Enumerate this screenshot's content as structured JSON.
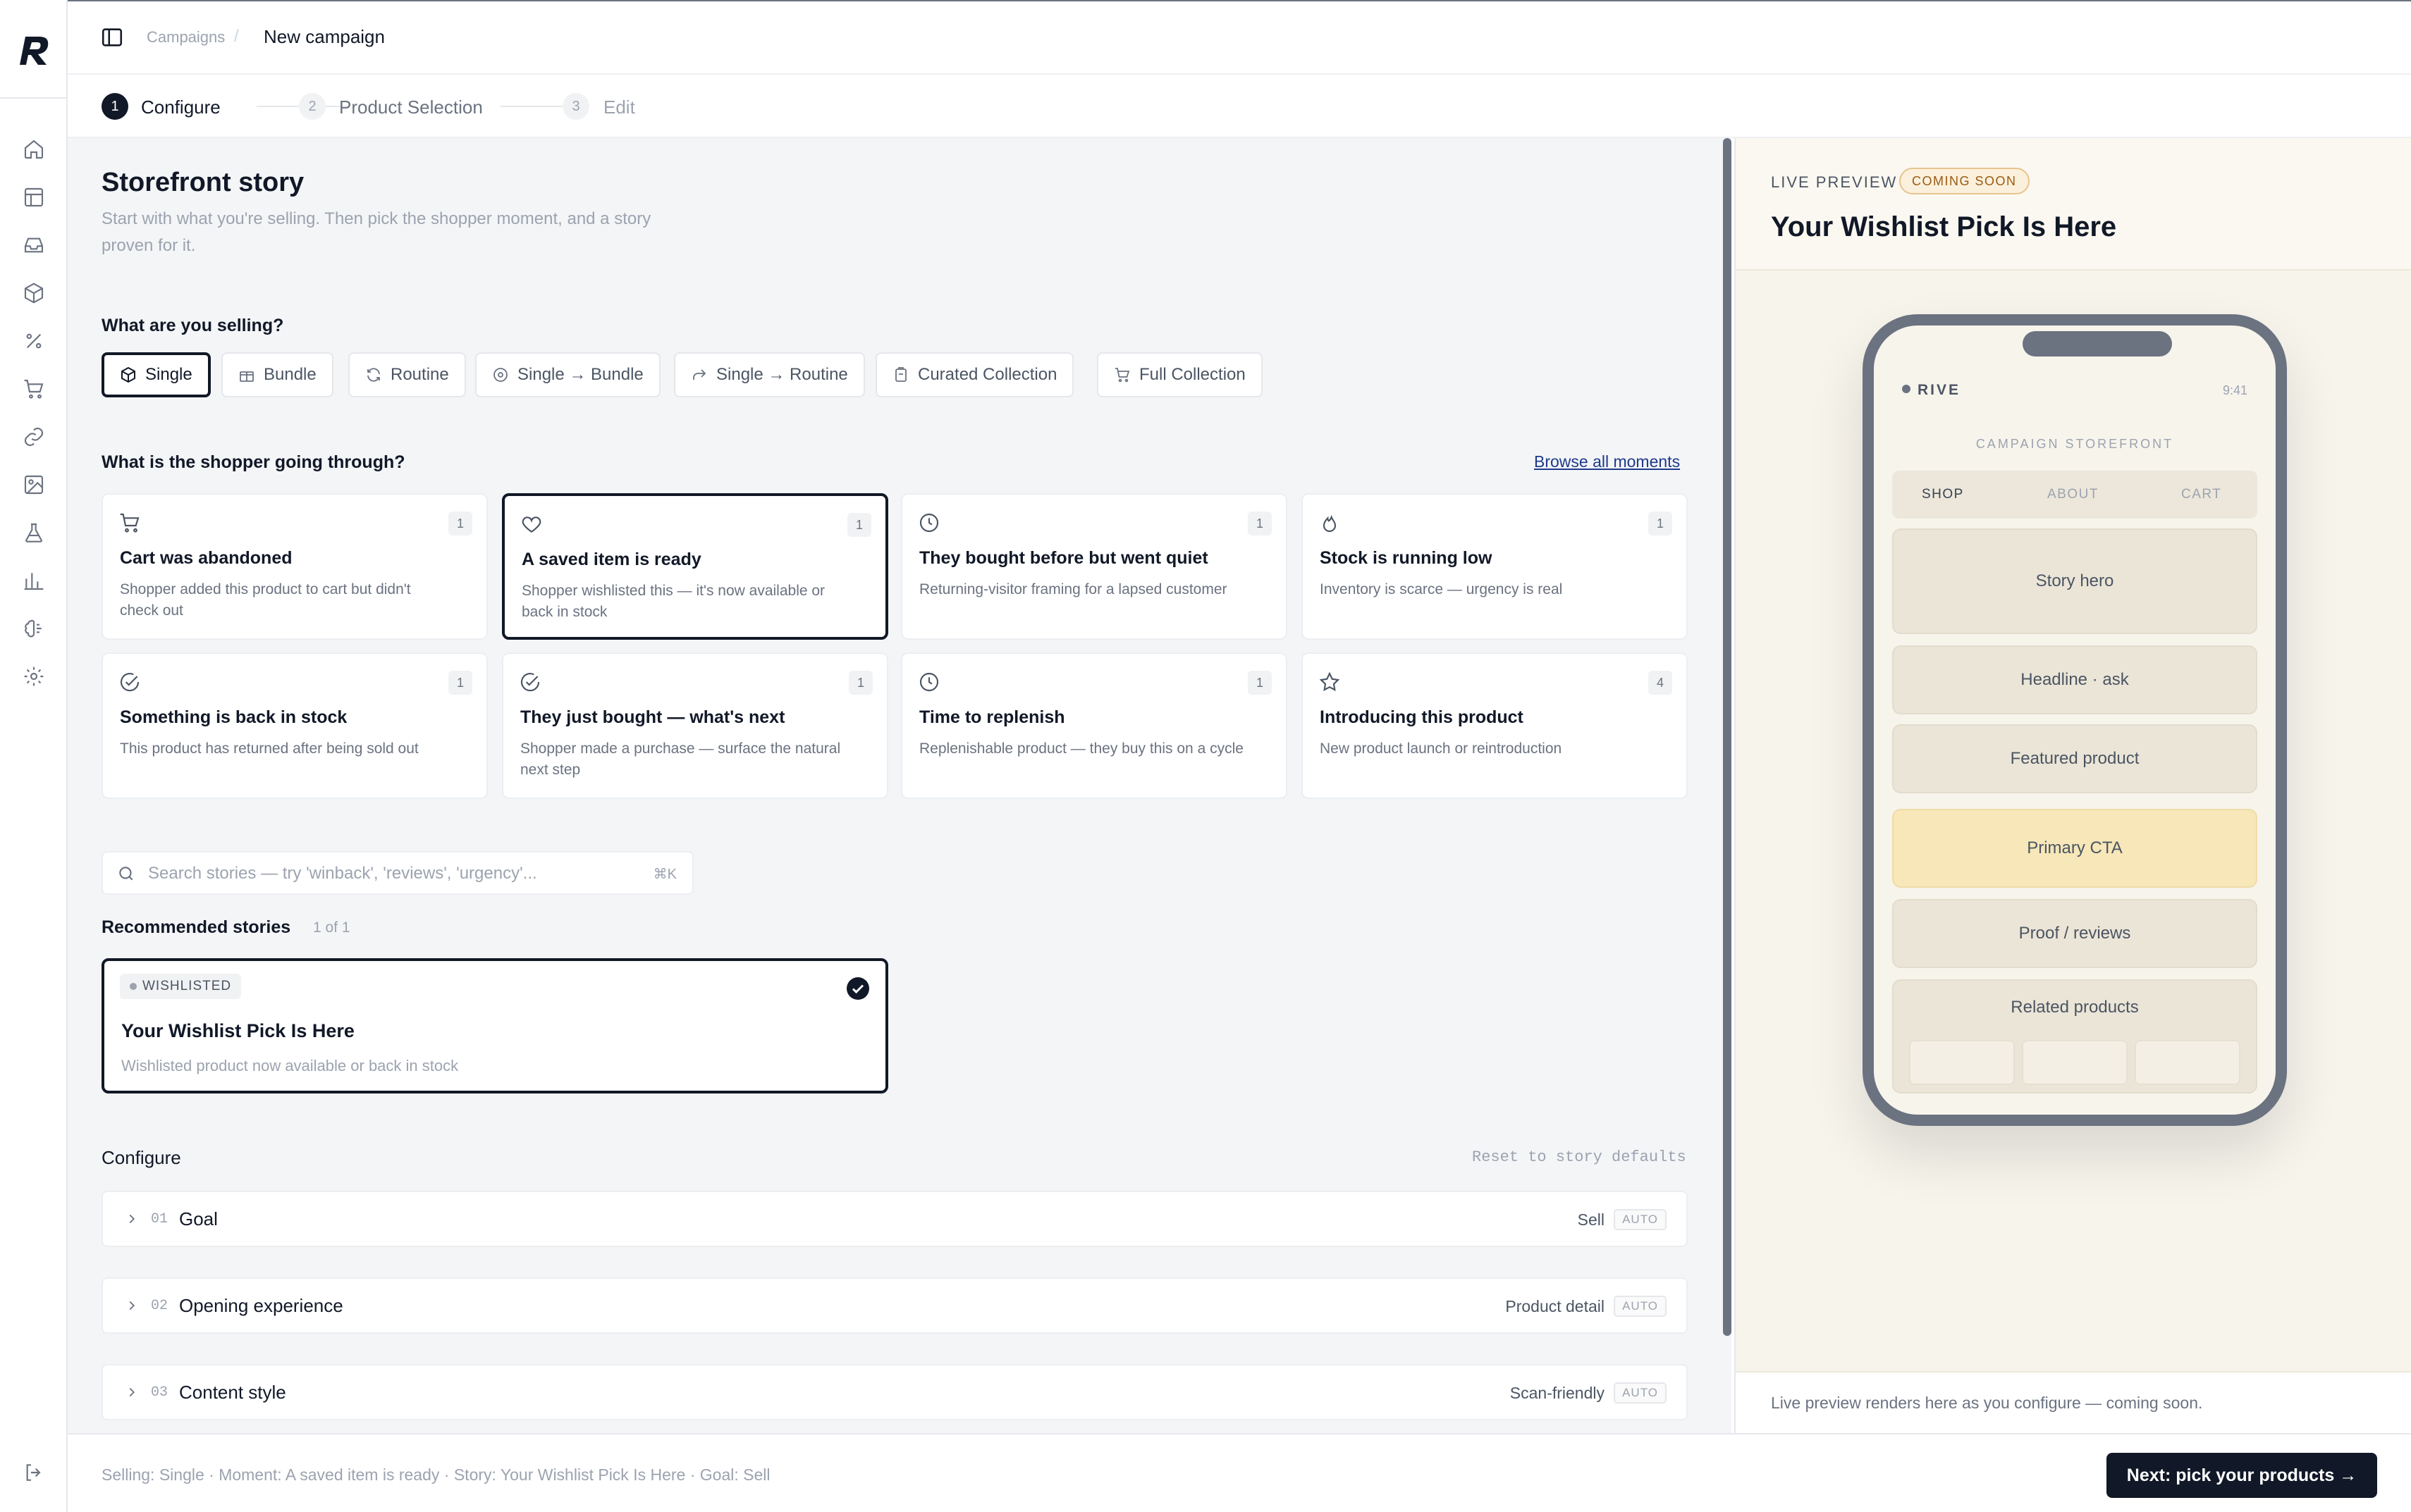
{
  "breadcrumb": {
    "parent": "Campaigns",
    "separator": "/",
    "current": "New campaign"
  },
  "stepper": [
    {
      "num": "1",
      "label": "Configure",
      "state": "active"
    },
    {
      "num": "2",
      "label": "Product Selection",
      "state": "todo"
    },
    {
      "num": "3",
      "label": "Edit",
      "state": "todo"
    }
  ],
  "main": {
    "title": "Storefront story",
    "subtitle_line1": "Start with what you're selling. Then pick the shopper moment, and a story",
    "subtitle_line2": "proven for it.",
    "selling_label": "What are you selling?",
    "selling_options": [
      {
        "label": "Single",
        "icon": "box-icon",
        "selected": true
      },
      {
        "label": "Bundle",
        "icon": "gift-icon",
        "selected": false
      },
      {
        "label": "Routine",
        "icon": "refresh-icon",
        "selected": false
      },
      {
        "label": "Single → Bundle",
        "icon": "circle-plus-icon",
        "selected": false
      },
      {
        "label": "Single → Routine",
        "icon": "share-arrow-icon",
        "selected": false
      },
      {
        "label": "Curated Collection",
        "icon": "clipboard-icon",
        "selected": false
      },
      {
        "label": "Full Collection",
        "icon": "cart-icon",
        "selected": false
      }
    ],
    "shopper_label": "What is the shopper going through?",
    "browse_link": "Browse all moments",
    "moments": [
      {
        "title": "Cart was abandoned",
        "desc": "Shopper added this product to cart but didn't check out",
        "count": "1",
        "icon": "cart-icon",
        "selected": false
      },
      {
        "title": "A saved item is ready",
        "desc": "Shopper wishlisted this — it's now available or back in stock",
        "count": "1",
        "icon": "heart-icon",
        "selected": true
      },
      {
        "title": "They bought before but went quiet",
        "desc": "Returning-visitor framing for a lapsed customer",
        "count": "1",
        "icon": "clock-icon",
        "selected": false
      },
      {
        "title": "Stock is running low",
        "desc": "Inventory is scarce — urgency is real",
        "count": "1",
        "icon": "flame-icon",
        "selected": false
      },
      {
        "title": "Something is back in stock",
        "desc": "This product has returned after being sold out",
        "count": "1",
        "icon": "check-circle-icon",
        "selected": false
      },
      {
        "title": "They just bought — what's next",
        "desc": "Shopper made a purchase — surface the natural next step",
        "count": "1",
        "icon": "check-circle-icon",
        "selected": false
      },
      {
        "title": "Time to replenish",
        "desc": "Replenishable product — they buy this on a cycle",
        "count": "1",
        "icon": "clock-icon",
        "selected": false
      },
      {
        "title": "Introducing this product",
        "desc": "New product launch or reintroduction",
        "count": "4",
        "icon": "star-icon",
        "selected": false
      }
    ],
    "search": {
      "placeholder": "Search stories — try 'winback', 'reviews', 'urgency'...",
      "shortcut": "⌘K"
    },
    "recommended_label": "Recommended stories",
    "recommended_count": "1 of 1",
    "story": {
      "tag": "WISHLISTED",
      "title": "Your Wishlist Pick Is Here",
      "desc": "Wishlisted product now available or back in stock"
    },
    "configure_label": "Configure",
    "reset_link": "Reset to story defaults",
    "config_rows": [
      {
        "num": "01",
        "name": "Goal",
        "value": "Sell",
        "tag": "AUTO"
      },
      {
        "num": "02",
        "name": "Opening experience",
        "value": "Product detail",
        "tag": "AUTO"
      },
      {
        "num": "03",
        "name": "Content style",
        "value": "Scan-friendly",
        "tag": "AUTO"
      }
    ]
  },
  "footer": {
    "summary": "Selling: Single · Moment: A saved item is ready · Story: Your Wishlist Pick Is Here · Goal: Sell",
    "next_button": "Next: pick your products →"
  },
  "preview": {
    "label": "LIVE PREVIEW",
    "badge": "COMING SOON",
    "title": "Your Wishlist Pick Is Here",
    "phone": {
      "brand": "RIVE",
      "time": "9:41",
      "storefront": "CAMPAIGN STOREFRONT",
      "tabs": [
        "SHOP",
        "ABOUT",
        "CART"
      ],
      "blocks": [
        "Story hero",
        "Headline · ask",
        "Featured product",
        "Primary CTA",
        "Proof / reviews",
        "Related products"
      ]
    },
    "footer_note": "Live preview renders here as you configure — coming soon."
  },
  "colors": {
    "accent": "#111827",
    "background": "#f4f5f7",
    "preview_bg": "#f7f4ec",
    "cta_block": "#f7e7b9",
    "badge": "#fbf0dc"
  },
  "sidebar_icons": [
    "home-icon",
    "layout-icon",
    "inbox-icon",
    "cube-icon",
    "percent-icon",
    "cart-icon",
    "link-icon",
    "image-icon",
    "flask-icon",
    "bar-chart-icon",
    "brain-icon",
    "settings-icon"
  ]
}
